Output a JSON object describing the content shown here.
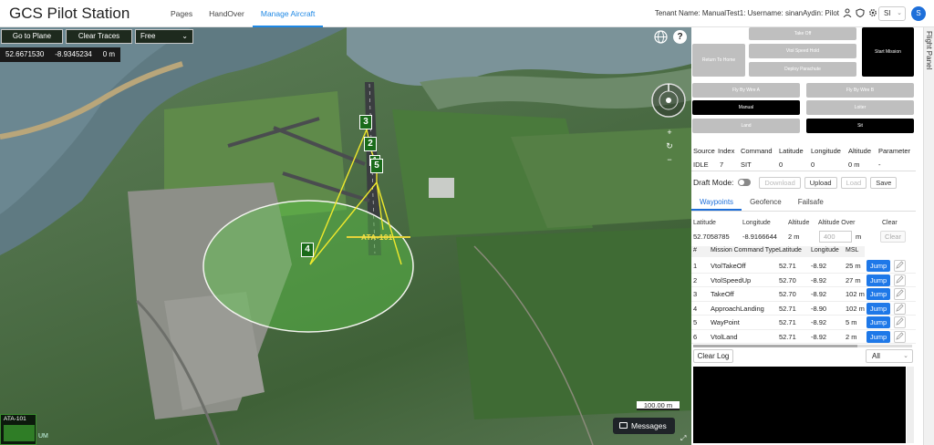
{
  "header": {
    "title": "GCS Pilot Station",
    "nav": [
      {
        "label": "Pages",
        "active": false
      },
      {
        "label": "HandOver",
        "active": false
      },
      {
        "label": "Manage Aircraft",
        "active": true
      }
    ],
    "user_info": "Tenant Name: ManualTest1: Username: sinanAydin: Pilot",
    "language": "SI",
    "avatar_initial": "S",
    "accent": "#1e88e5"
  },
  "map": {
    "buttons": {
      "go_to_plane": "Go to Plane",
      "clear_traces": "Clear Traces",
      "view_mode": "Free"
    },
    "coords": {
      "lat": "52.6671530",
      "lon": "-8.9345234",
      "alt": "0 m"
    },
    "help": "?",
    "zoom_in": "+",
    "reset": "↻",
    "zoom_out": "−",
    "scale": "100.00 m",
    "messages": "Messages",
    "runway_label": "ATA-101",
    "mini_label": "ATA-101",
    "attribution": "UM",
    "waypoint_markers": [
      "3",
      "2",
      "1",
      "5",
      "4"
    ]
  },
  "commands": {
    "take_off": "Take Off",
    "return_to_home": "Return To Home",
    "vtol_speed_hold": "Vtol Speed Hold",
    "start_mission": "Start Mission",
    "deploy_parachute": "Deploy Parachute",
    "fly_by_wire_a": "Fly By Wire A",
    "fly_by_wire_b": "Fly By Wire B",
    "manual": "Manual",
    "loiter": "Loiter",
    "land": "Land",
    "sit": "Sit"
  },
  "status": {
    "headers": [
      "Source",
      "Index",
      "Command",
      "Latitude",
      "Longitude",
      "Altitude",
      "Parameter"
    ],
    "values": [
      "IDLE",
      "7",
      "SIT",
      "0",
      "0",
      "0 m",
      "-"
    ]
  },
  "draft": {
    "label": "Draft Mode:",
    "download": "Download",
    "upload": "Upload",
    "load": "Load",
    "save": "Save"
  },
  "tabs": [
    {
      "label": "Waypoints",
      "active": true
    },
    {
      "label": "Geofence",
      "active": false
    },
    {
      "label": "Failsafe",
      "active": false
    }
  ],
  "new_waypoint": {
    "headers": [
      "Latitude",
      "Longitude",
      "Altitude",
      "Altitude Over",
      "Clear"
    ],
    "latitude": "52.7058785",
    "longitude": "-8.9166644",
    "altitude": "2 m",
    "altitude_over_placeholder": "400",
    "altitude_over_unit": "m",
    "clear": "Clear"
  },
  "mission": {
    "headers": [
      "#",
      "Mission Command Type",
      "Latitude",
      "Longitude",
      "MSL"
    ],
    "jump_label": "Jump",
    "rows": [
      {
        "n": "1",
        "type": "VtolTakeOff",
        "lat": "52.71",
        "lon": "-8.92",
        "msl": "25 m"
      },
      {
        "n": "2",
        "type": "VtolSpeedUp",
        "lat": "52.70",
        "lon": "-8.92",
        "msl": "27 m"
      },
      {
        "n": "3",
        "type": "TakeOff",
        "lat": "52.70",
        "lon": "-8.92",
        "msl": "102 m"
      },
      {
        "n": "4",
        "type": "ApproachLanding",
        "lat": "52.71",
        "lon": "-8.90",
        "msl": "102 m"
      },
      {
        "n": "5",
        "type": "WayPoint",
        "lat": "52.71",
        "lon": "-8.92",
        "msl": "5 m"
      },
      {
        "n": "6",
        "type": "VtolLand",
        "lat": "52.71",
        "lon": "-8.92",
        "msl": "2 m"
      }
    ]
  },
  "log": {
    "clear": "Clear Log",
    "filter": "All"
  },
  "side_tab": "Flight Panel"
}
